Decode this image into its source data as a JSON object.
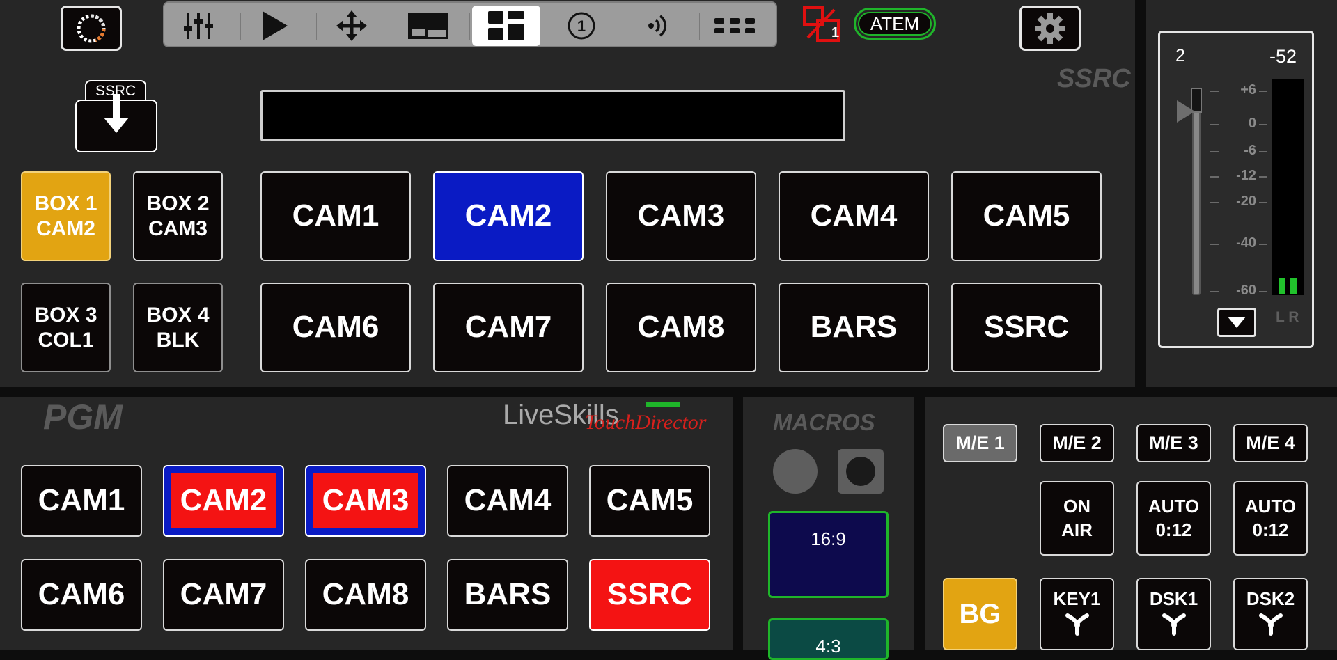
{
  "toolbar": {
    "tools": [
      {
        "name": "mixer-sliders-icon",
        "active": false
      },
      {
        "name": "play-icon",
        "active": false
      },
      {
        "name": "move-arrows-icon",
        "active": false
      },
      {
        "name": "multiview-icon",
        "active": false
      },
      {
        "name": "layout-grid-icon",
        "active": true
      },
      {
        "name": "number-one-icon",
        "active": false
      },
      {
        "name": "broadcast-icon",
        "active": false
      },
      {
        "name": "more-dots-icon",
        "active": false
      }
    ],
    "unlink_badge": "1",
    "atem_label": "ATEM"
  },
  "ssrc": {
    "section_label": "SSRC",
    "download_label": "SSRC",
    "name_field_value": "",
    "boxes": [
      {
        "line1": "BOX 1",
        "line2": "CAM2",
        "state": "selected"
      },
      {
        "line1": "BOX 2",
        "line2": "CAM3",
        "state": "normal"
      },
      {
        "line1": "BOX 3",
        "line2": "COL1",
        "state": "dim"
      },
      {
        "line1": "BOX 4",
        "line2": "BLK",
        "state": "dim"
      }
    ],
    "sources": [
      "CAM1",
      "CAM2",
      "CAM3",
      "CAM4",
      "CAM5",
      "CAM6",
      "CAM7",
      "CAM8",
      "BARS",
      "SSRC"
    ],
    "selected_source": "CAM2"
  },
  "audio": {
    "channel": "2",
    "level": "-52",
    "scale": [
      "+6",
      "0",
      "-6",
      "-12",
      "-20",
      "-40",
      "-60"
    ],
    "lr_label": "L R"
  },
  "pgm": {
    "section_label": "PGM",
    "brand_main": "LiveSkills",
    "brand_sub": "TouchDirector",
    "sources": [
      "CAM1",
      "CAM2",
      "CAM3",
      "CAM4",
      "CAM5",
      "CAM6",
      "CAM7",
      "CAM8",
      "BARS",
      "SSRC"
    ],
    "states": [
      "normal",
      "dual",
      "dual",
      "normal",
      "normal",
      "normal",
      "normal",
      "normal",
      "normal",
      "program"
    ]
  },
  "macros": {
    "section_label": "MACROS",
    "items": [
      "16:9",
      "4:3"
    ]
  },
  "me": {
    "tabs": [
      "M/E 1",
      "M/E 2",
      "M/E 3",
      "M/E 4"
    ],
    "active_tab": "M/E 1",
    "on_air": {
      "line1": "ON",
      "line2": "AIR"
    },
    "auto_1": {
      "line1": "AUTO",
      "line2": "0:12"
    },
    "auto_2": {
      "line1": "AUTO",
      "line2": "0:12"
    },
    "bg_label": "BG",
    "keys": [
      "KEY1",
      "DSK1",
      "DSK2"
    ]
  },
  "colors": {
    "preview_blue": "#0a1bc4",
    "program_red": "#f41313",
    "box_yellow": "#e2a412",
    "macro_green": "#1fb52a"
  }
}
